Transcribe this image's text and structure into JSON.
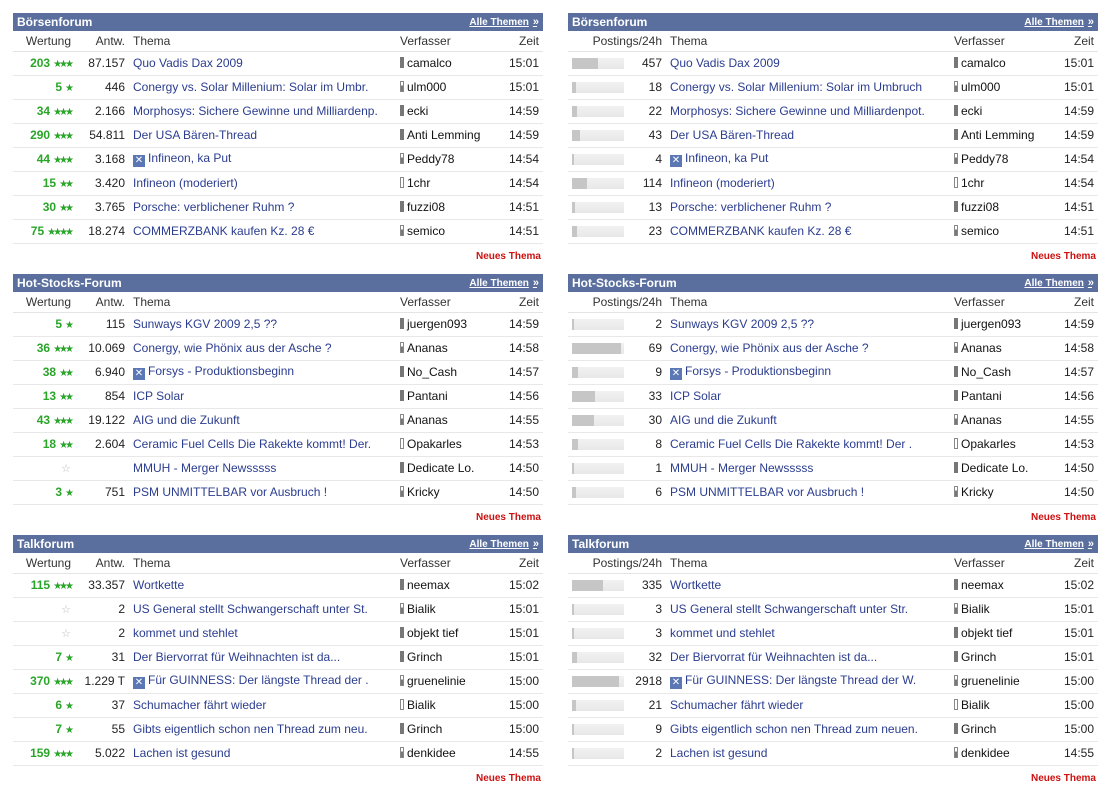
{
  "labels": {
    "all_topics": "Alle Themen",
    "new_thread": "Neues Thema",
    "col_rating": "Wertung",
    "col_replies": "Antw.",
    "col_topic": "Thema",
    "col_author": "Verfasser",
    "col_time": "Zeit",
    "col_postings": "Postings/24h"
  },
  "icons": {
    "all_topics": "double-chevron-right-icon",
    "thread_closed": "x-icon",
    "rating": "star-icon",
    "author_status": "status-bar-icon"
  },
  "colors": {
    "header_bg": "#5a6f9e",
    "rating_green": "#2aa52a",
    "link_blue": "#2b3d8f",
    "new_thread_red": "#cc1111"
  },
  "left": [
    {
      "title": "Börsenforum",
      "rows": [
        {
          "rating": "203",
          "stars": "★★★",
          "replies": "87.157",
          "icon": false,
          "topic": "Quo Vadis Dax 2009",
          "author": "camalco",
          "time": "15:01"
        },
        {
          "rating": "5",
          "stars": "★",
          "replies": "446",
          "icon": false,
          "topic": "Conergy vs. Solar Millenium: Solar im Umbr.",
          "author": "ulm000",
          "time": "15:01"
        },
        {
          "rating": "34",
          "stars": "★★★",
          "replies": "2.166",
          "icon": false,
          "topic": "Morphosys: Sichere Gewinne und Milliardenp.",
          "author": "ecki",
          "time": "14:59"
        },
        {
          "rating": "290",
          "stars": "★★★",
          "replies": "54.811",
          "icon": false,
          "topic": "Der USA Bären-Thread",
          "author": "Anti Lemming",
          "time": "14:59"
        },
        {
          "rating": "44",
          "stars": "★★★",
          "replies": "3.168",
          "icon": true,
          "topic": "Infineon, ka Put",
          "author": "Peddy78",
          "time": "14:54"
        },
        {
          "rating": "15",
          "stars": "★★",
          "replies": "3.420",
          "icon": false,
          "topic": "Infineon (moderiert)",
          "author": "1chr",
          "time": "14:54"
        },
        {
          "rating": "30",
          "stars": "★★",
          "replies": "3.765",
          "icon": false,
          "topic": "Porsche: verblichener Ruhm ?",
          "author": "fuzzi08",
          "time": "14:51"
        },
        {
          "rating": "75",
          "stars": "★★★★",
          "replies": "18.274",
          "icon": false,
          "topic": "COMMERZBANK kaufen Kz. 28 €",
          "author": "semico",
          "time": "14:51"
        }
      ]
    },
    {
      "title": "Hot-Stocks-Forum",
      "rows": [
        {
          "rating": "5",
          "stars": "★",
          "replies": "115",
          "icon": false,
          "topic": "Sunways KGV 2009 2,5 ??",
          "author": "juergen093",
          "time": "14:59"
        },
        {
          "rating": "36",
          "stars": "★★★",
          "replies": "10.069",
          "icon": false,
          "topic": "Conergy, wie Phönix aus der Asche ?",
          "author": "Ananas",
          "time": "14:58"
        },
        {
          "rating": "38",
          "stars": "★★",
          "replies": "6.940",
          "icon": true,
          "topic": "Forsys - Produktionsbeginn",
          "author": "No_Cash",
          "time": "14:57"
        },
        {
          "rating": "13",
          "stars": "★★",
          "replies": "854",
          "icon": false,
          "topic": "ICP Solar",
          "author": "Pantani",
          "time": "14:56"
        },
        {
          "rating": "43",
          "stars": "★★★",
          "replies": "19.122",
          "icon": false,
          "topic": "AIG und die Zukunft",
          "author": "Ananas",
          "time": "14:55"
        },
        {
          "rating": "18",
          "stars": "★★",
          "replies": "2.604",
          "icon": false,
          "topic": "Ceramic Fuel Cells Die Rakekte kommt! Der.",
          "author": "Opakarles",
          "time": "14:53"
        },
        {
          "rating": "",
          "stars": "",
          "replies": "",
          "icon": false,
          "topic": "MMUH - Merger Newsssss",
          "author": "Dedicate Lo.",
          "time": "14:50"
        },
        {
          "rating": "3",
          "stars": "★",
          "replies": "751",
          "icon": false,
          "topic": "PSM UNMITTELBAR vor Ausbruch !",
          "author": "Kricky",
          "time": "14:50"
        }
      ]
    },
    {
      "title": "Talkforum",
      "rows": [
        {
          "rating": "115",
          "stars": "★★★",
          "replies": "33.357",
          "icon": false,
          "topic": "Wortkette",
          "author": "neemax",
          "time": "15:02"
        },
        {
          "rating": "",
          "stars": "",
          "replies": "2",
          "icon": false,
          "topic": "US General stellt Schwangerschaft unter St.",
          "author": "Bialik",
          "time": "15:01"
        },
        {
          "rating": "",
          "stars": "",
          "replies": "2",
          "icon": false,
          "topic": "kommet und stehlet",
          "author": "objekt tief",
          "time": "15:01"
        },
        {
          "rating": "7",
          "stars": "★",
          "replies": "31",
          "icon": false,
          "topic": "Der Biervorrat für Weihnachten ist da...",
          "author": "Grinch",
          "time": "15:01"
        },
        {
          "rating": "370",
          "stars": "★★★",
          "replies": "1.229 T",
          "icon": true,
          "topic": "Für GUINNESS: Der längste Thread der .",
          "author": "gruenelinie",
          "time": "15:00"
        },
        {
          "rating": "6",
          "stars": "★",
          "replies": "37",
          "icon": false,
          "topic": "Schumacher fährt wieder",
          "author": "Bialik",
          "time": "15:00"
        },
        {
          "rating": "7",
          "stars": "★",
          "replies": "55",
          "icon": false,
          "topic": "Gibts eigentlich schon nen Thread zum neu.",
          "author": "Grinch",
          "time": "15:00"
        },
        {
          "rating": "159",
          "stars": "★★★",
          "replies": "5.022",
          "icon": false,
          "topic": "Lachen ist gesund",
          "author": "denkidee",
          "time": "14:55"
        }
      ]
    }
  ],
  "right": [
    {
      "title": "Börsenforum",
      "rows": [
        {
          "bar": 0.5,
          "postings": "457",
          "icon": false,
          "topic": "Quo Vadis Dax 2009",
          "author": "camalco",
          "time": "15:01"
        },
        {
          "bar": 0.08,
          "postings": "18",
          "icon": false,
          "topic": "Conergy vs. Solar Millenium: Solar im Umbruch",
          "author": "ulm000",
          "time": "15:01"
        },
        {
          "bar": 0.1,
          "postings": "22",
          "icon": false,
          "topic": "Morphosys: Sichere Gewinne und Milliardenpot.",
          "author": "ecki",
          "time": "14:59"
        },
        {
          "bar": 0.15,
          "postings": "43",
          "icon": false,
          "topic": "Der USA Bären-Thread",
          "author": "Anti Lemming",
          "time": "14:59"
        },
        {
          "bar": 0.03,
          "postings": "4",
          "icon": true,
          "topic": "Infineon, ka Put",
          "author": "Peddy78",
          "time": "14:54"
        },
        {
          "bar": 0.28,
          "postings": "114",
          "icon": false,
          "topic": "Infineon (moderiert)",
          "author": "1chr",
          "time": "14:54"
        },
        {
          "bar": 0.06,
          "postings": "13",
          "icon": false,
          "topic": "Porsche: verblichener Ruhm ?",
          "author": "fuzzi08",
          "time": "14:51"
        },
        {
          "bar": 0.09,
          "postings": "23",
          "icon": false,
          "topic": "COMMERZBANK kaufen Kz. 28 €",
          "author": "semico",
          "time": "14:51"
        }
      ]
    },
    {
      "title": "Hot-Stocks-Forum",
      "rows": [
        {
          "bar": 0.02,
          "postings": "2",
          "icon": false,
          "topic": "Sunways KGV 2009 2,5 ??",
          "author": "juergen093",
          "time": "14:59"
        },
        {
          "bar": 0.95,
          "postings": "69",
          "icon": false,
          "topic": "Conergy, wie Phönix aus der Asche ?",
          "author": "Ananas",
          "time": "14:58"
        },
        {
          "bar": 0.12,
          "postings": "9",
          "icon": true,
          "topic": "Forsys - Produktionsbeginn",
          "author": "No_Cash",
          "time": "14:57"
        },
        {
          "bar": 0.45,
          "postings": "33",
          "icon": false,
          "topic": "ICP Solar",
          "author": "Pantani",
          "time": "14:56"
        },
        {
          "bar": 0.42,
          "postings": "30",
          "icon": false,
          "topic": "AIG und die Zukunft",
          "author": "Ananas",
          "time": "14:55"
        },
        {
          "bar": 0.11,
          "postings": "8",
          "icon": false,
          "topic": "Ceramic Fuel Cells Die Rakekte kommt! Der .",
          "author": "Opakarles",
          "time": "14:53"
        },
        {
          "bar": 0.01,
          "postings": "1",
          "icon": false,
          "topic": "MMUH - Merger Newsssss",
          "author": "Dedicate Lo.",
          "time": "14:50"
        },
        {
          "bar": 0.08,
          "postings": "6",
          "icon": false,
          "topic": "PSM UNMITTELBAR vor Ausbruch !",
          "author": "Kricky",
          "time": "14:50"
        }
      ]
    },
    {
      "title": "Talkforum",
      "rows": [
        {
          "bar": 0.6,
          "postings": "335",
          "icon": false,
          "topic": "Wortkette",
          "author": "neemax",
          "time": "15:02"
        },
        {
          "bar": 0.02,
          "postings": "3",
          "icon": false,
          "topic": "US General stellt Schwangerschaft unter Str.",
          "author": "Bialik",
          "time": "15:01"
        },
        {
          "bar": 0.02,
          "postings": "3",
          "icon": false,
          "topic": "kommet und stehlet",
          "author": "objekt tief",
          "time": "15:01"
        },
        {
          "bar": 0.1,
          "postings": "32",
          "icon": false,
          "topic": "Der Biervorrat für Weihnachten ist da...",
          "author": "Grinch",
          "time": "15:01"
        },
        {
          "bar": 0.9,
          "postings": "2918",
          "icon": true,
          "topic": "Für GUINNESS: Der längste Thread der W.",
          "author": "gruenelinie",
          "time": "15:00"
        },
        {
          "bar": 0.08,
          "postings": "21",
          "icon": false,
          "topic": "Schumacher fährt wieder",
          "author": "Bialik",
          "time": "15:00"
        },
        {
          "bar": 0.03,
          "postings": "9",
          "icon": false,
          "topic": "Gibts eigentlich schon nen Thread zum neuen.",
          "author": "Grinch",
          "time": "15:00"
        },
        {
          "bar": 0.01,
          "postings": "2",
          "icon": false,
          "topic": "Lachen ist gesund",
          "author": "denkidee",
          "time": "14:55"
        }
      ]
    }
  ]
}
